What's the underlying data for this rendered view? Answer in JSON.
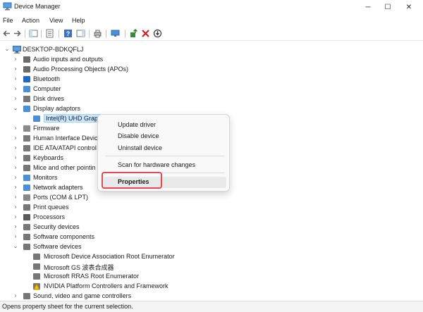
{
  "window": {
    "title": "Device Manager",
    "minimize_glyph": "─",
    "maximize_glyph": "☐",
    "close_glyph": "✕"
  },
  "menu": [
    "File",
    "Action",
    "View",
    "Help"
  ],
  "toolbar": {
    "icons": [
      "back-icon",
      "forward-icon",
      "show-hide-console-tree-icon",
      "properties-icon",
      "help-icon",
      "action-pane-icon",
      "print-icon",
      "monitor-icon",
      "update-driver-icon",
      "uninstall-icon",
      "scan-icon"
    ]
  },
  "tree": {
    "root": "DESKTOP-BDKQFLJ",
    "items": [
      {
        "label": "Audio inputs and outputs",
        "expanded": false
      },
      {
        "label": "Audio Processing Objects (APOs)",
        "expanded": false
      },
      {
        "label": "Bluetooth",
        "expanded": false
      },
      {
        "label": "Computer",
        "expanded": false
      },
      {
        "label": "Disk drives",
        "expanded": false
      },
      {
        "label": "Display adaptors",
        "expanded": true
      },
      {
        "label": "Intel(R) UHD Graph",
        "child": true,
        "selected": true
      },
      {
        "label": "Firmware",
        "expanded": false
      },
      {
        "label": "Human Interface Devic",
        "expanded": false
      },
      {
        "label": "IDE ATA/ATAPI control",
        "expanded": false
      },
      {
        "label": "Keyboards",
        "expanded": false
      },
      {
        "label": "Mice and other pointin",
        "expanded": false
      },
      {
        "label": "Monitors",
        "expanded": false
      },
      {
        "label": "Network adapters",
        "expanded": false
      },
      {
        "label": "Ports (COM & LPT)",
        "expanded": false
      },
      {
        "label": "Print queues",
        "expanded": false
      },
      {
        "label": "Processors",
        "expanded": false
      },
      {
        "label": "Security devices",
        "expanded": false
      },
      {
        "label": "Software components",
        "expanded": false
      },
      {
        "label": "Software devices",
        "expanded": true
      },
      {
        "label": "Microsoft Device Association Root Enumerator",
        "child": true
      },
      {
        "label": "Microsoft GS 波表合成器",
        "child": true
      },
      {
        "label": "Microsoft RRAS Root Enumerator",
        "child": true
      },
      {
        "label": "NVIDIA Platform Controllers and Framework",
        "child": true,
        "warning": true
      },
      {
        "label": "Sound, video and game controllers",
        "expanded": false
      }
    ]
  },
  "context_menu": {
    "items": [
      "Update driver",
      "Disable device",
      "Uninstall device",
      "Scan for hardware changes",
      "Properties"
    ],
    "highlighted": "Properties",
    "outline_color": "#e8484f"
  },
  "status": "Opens property sheet for the current selection."
}
